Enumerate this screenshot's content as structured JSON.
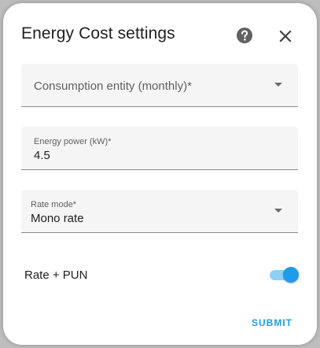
{
  "dialog": {
    "title": "Energy Cost settings",
    "help_icon": "help-circle-icon",
    "close_icon": "close-icon"
  },
  "form": {
    "consumption_entity": {
      "label": "Consumption entity (monthly)*",
      "value": ""
    },
    "energy_power": {
      "label": "Energy power (kW)*",
      "value": "4.5"
    },
    "rate_mode": {
      "label": "Rate mode*",
      "value": "Mono rate"
    },
    "rate_pun": {
      "label": "Rate + PUN",
      "enabled": true
    }
  },
  "actions": {
    "submit_label": "SUBMIT"
  },
  "colors": {
    "accent": "#1e9be9",
    "accent_track": "#8fd0f7",
    "field_background": "#f5f5f5",
    "text_primary": "#212121",
    "text_secondary": "#5f5f5f"
  }
}
